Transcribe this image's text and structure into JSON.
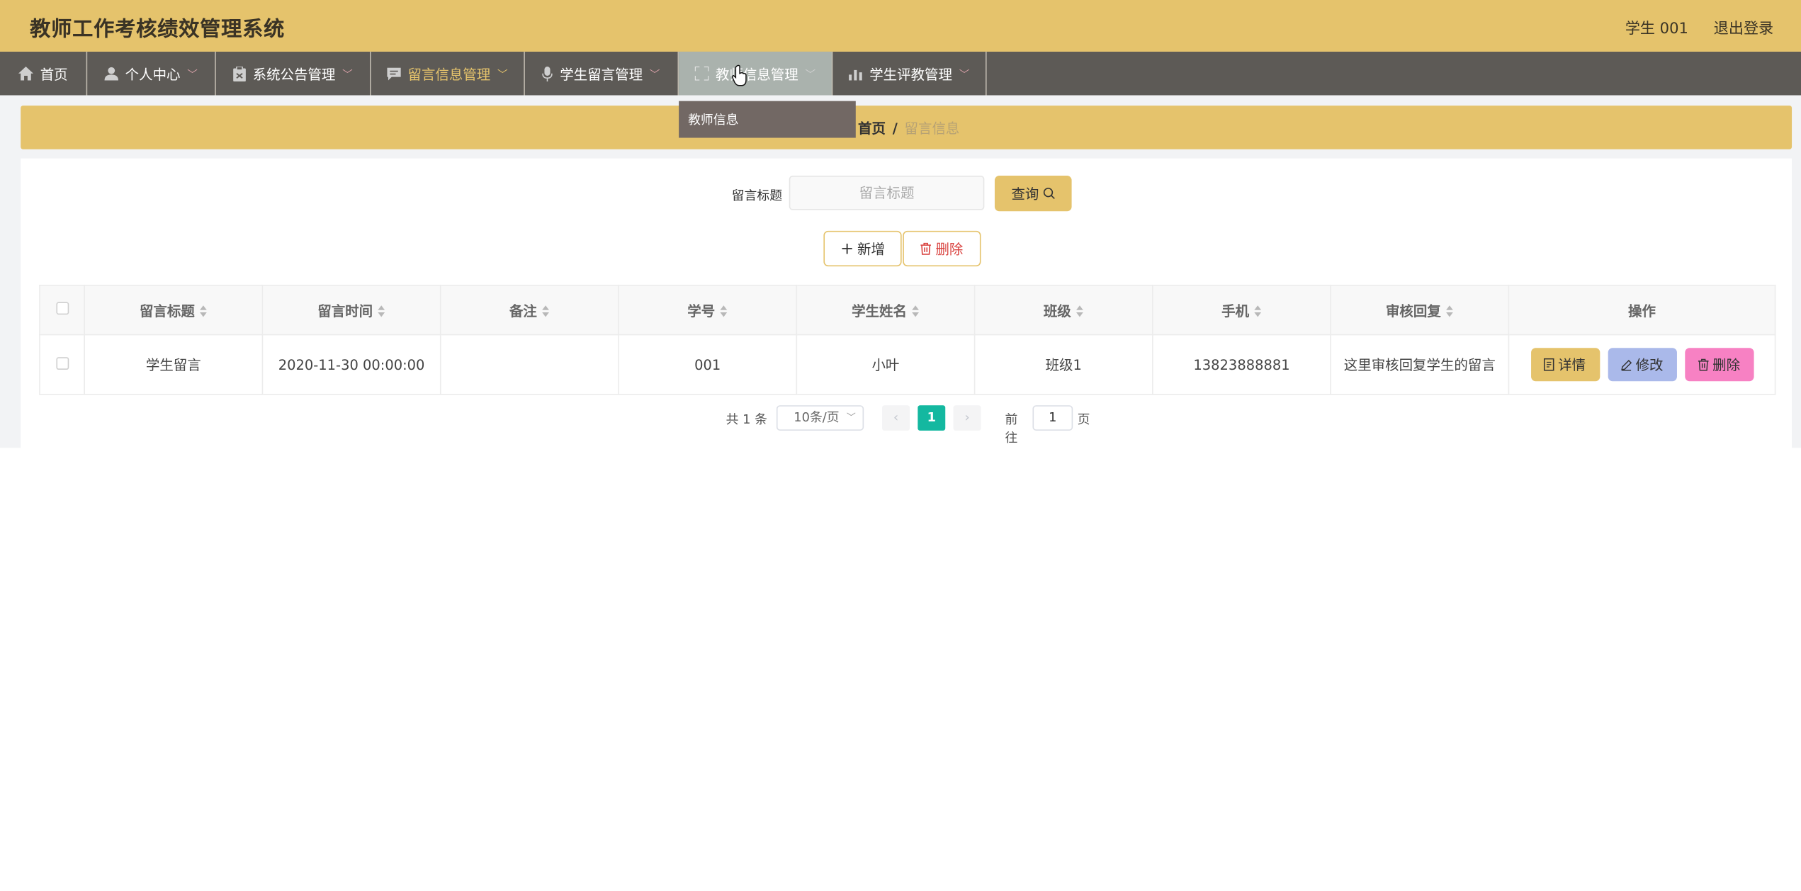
{
  "header": {
    "title": "教师工作考核绩效管理系统",
    "user": "学生 001",
    "logout": "退出登录"
  },
  "nav": {
    "items": [
      {
        "label": "首页",
        "icon": "home-icon"
      },
      {
        "label": "个人中心",
        "icon": "user-icon"
      },
      {
        "label": "系统公告管理",
        "icon": "clipboard-icon"
      },
      {
        "label": "留言信息管理",
        "icon": "chat-icon"
      },
      {
        "label": "学生留言管理",
        "icon": "microphone-icon"
      },
      {
        "label": "教师信息管理",
        "icon": "expand-icon"
      },
      {
        "label": "学生评教管理",
        "icon": "bar-chart-icon"
      }
    ],
    "dropdown": {
      "item": "教师信息"
    },
    "active_color": "#e5c36c"
  },
  "breadcrumb": {
    "home": "首页",
    "separator": "/",
    "current": "留言信息"
  },
  "search": {
    "label": "留言标题",
    "placeholder": "留言标题",
    "button": "查询"
  },
  "actions": {
    "add": "新增",
    "delete": "删除"
  },
  "table": {
    "headers": [
      "留言标题",
      "留言时间",
      "备注",
      "学号",
      "学生姓名",
      "班级",
      "手机",
      "审核回复",
      "操作"
    ],
    "rows": [
      {
        "title": "学生留言",
        "time": "2020-11-30 00:00:00",
        "note": "",
        "student_id": "001",
        "name": "小叶",
        "class": "班级1",
        "phone": "13823888881",
        "reply": "这里审核回复学生的留言"
      }
    ],
    "row_actions": {
      "detail": "详情",
      "edit": "修改",
      "delete": "删除"
    }
  },
  "pagination": {
    "total": "共 1 条",
    "page_size": "10条/页",
    "current": "1",
    "goto": "前往",
    "goto_value": "1",
    "page_unit": "页"
  },
  "colors": {
    "primary": "#e5c36c",
    "nav_bg": "#5d5a56",
    "page_active": "#14b8a0",
    "edit_btn": "#aab9ea",
    "delete_btn": "#f781c3"
  }
}
